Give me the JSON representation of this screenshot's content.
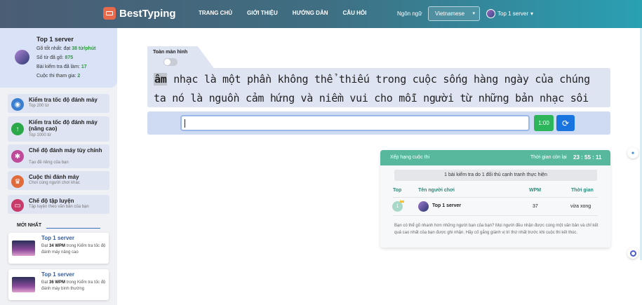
{
  "header": {
    "brand": "BestTyping",
    "nav": [
      "TRANG CHỦ",
      "GIỚI THIỆU",
      "HƯỚNG DẪN",
      "CÂU HỎI"
    ],
    "lang_label": "Ngôn ngữ",
    "lang_value": "Vietnamese",
    "user": "Top 1 server"
  },
  "profile": {
    "name": "Top 1 server",
    "best_label": "Gõ tốt nhất: đạt ",
    "best_value": "38 từ/phút",
    "words_label": "Số từ đã gõ: ",
    "words_value": "875",
    "tests_label": "Bài kiểm tra đã làm: ",
    "tests_value": "17",
    "contests_label": "Cuộc thi tham gia: ",
    "contests_value": "2"
  },
  "menu": [
    {
      "title": "Kiểm tra tốc độ đánh máy",
      "sub": "Top 200 từ",
      "color": "#3a7fd0",
      "icon": "speed-icon"
    },
    {
      "title": "Kiểm tra tốc độ đánh máy (nâng cao)",
      "sub": "Top 1000 từ",
      "color": "#2aa84a",
      "icon": "arrow-up-icon"
    },
    {
      "title": "Chế độ đánh máy tùy chỉnh",
      "sub": "Tạo đề riêng của bạn",
      "color": "#c04a9a",
      "icon": "share-icon"
    },
    {
      "title": "Cuộc thi đánh máy",
      "sub": "Chơi cùng người chơi khác",
      "color": "#e06a3a",
      "icon": "trophy-icon"
    },
    {
      "title": "Chế độ tập luyện",
      "sub": "Tập luyện theo văn bản của bạn",
      "color": "#c83a6a",
      "icon": "keyboard-icon"
    }
  ],
  "latest_title": "MỚI NHẤT",
  "latest": [
    {
      "user": "Top 1 server",
      "pre": "Đạt ",
      "wpm": "34 WPM",
      "post": " trong Kiểm tra tốc độ đánh máy nâng cao"
    },
    {
      "user": "Top 1 server",
      "pre": "Đạt ",
      "wpm": "36 WPM",
      "post": " trong Kiểm tra tốc độ đánh máy bình thường"
    }
  ],
  "typing": {
    "fullscreen_label": "Toàn màn hình",
    "current_word": "âm",
    "line1_rest": " nhạc là một phần không thể thiếu trong cuộc sống hàng ngày của chúng",
    "line2": "ta nó là nguồn cảm hứng và niềm vui cho mỗi người từ những bản nhạc sôi",
    "input_value": "",
    "timer": "1:00"
  },
  "contest": {
    "title": "Xếp hạng cuộc thi",
    "time_label": "Thời gian còn lại",
    "time_value": "23 : 55 : 11",
    "notice": "1 bài kiểm tra do 1 đối thủ cạnh tranh thực hiện",
    "columns": [
      "Top",
      "Tên người chơi",
      "WPM",
      "Thời gian"
    ],
    "rows": [
      {
        "rank": "1",
        "name": "Top 1 server",
        "wpm": "37",
        "time": "vừa xong"
      }
    ],
    "footer": "Bạn có thể gõ nhanh hơn những người bạn của bạn? Mọi người đều nhận được cùng một văn bản và chỉ kết quả cao nhất của bạn được ghi nhận. Hãy cố gắng giành vị trí thứ nhất trước khi cuộc thi kết thúc."
  }
}
